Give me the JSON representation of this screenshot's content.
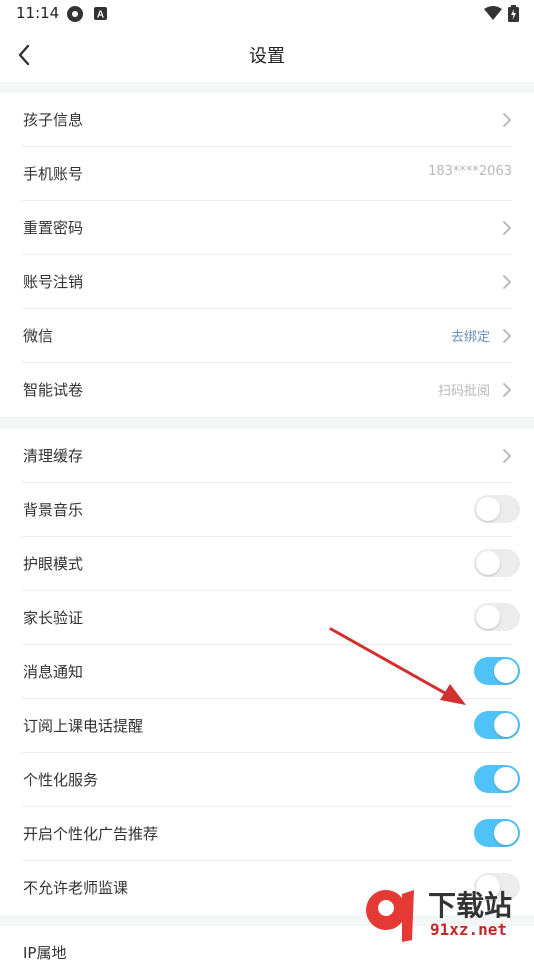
{
  "statusbar": {
    "time": "11:14"
  },
  "header": {
    "title": "设置"
  },
  "section1": [
    {
      "label": "孩子信息",
      "value": "",
      "chevron": true
    },
    {
      "label": "手机账号",
      "value": "183****2063",
      "chevron": false
    },
    {
      "label": "重置密码",
      "value": "",
      "chevron": true
    },
    {
      "label": "账号注销",
      "value": "",
      "chevron": true
    },
    {
      "label": "微信",
      "value": "去绑定",
      "chevron": true
    },
    {
      "label": "智能试卷",
      "value": "扫码批阅",
      "chevron": true
    }
  ],
  "section2": [
    {
      "label": "清理缓存",
      "type": "chevron"
    },
    {
      "label": "背景音乐",
      "type": "toggle",
      "on": false
    },
    {
      "label": "护眼模式",
      "type": "toggle",
      "on": false
    },
    {
      "label": "家长验证",
      "type": "toggle",
      "on": false
    },
    {
      "label": "消息通知",
      "type": "toggle",
      "on": true
    },
    {
      "label": "订阅上课电话提醒",
      "type": "toggle",
      "on": true
    },
    {
      "label": "个性化服务",
      "type": "toggle",
      "on": true
    },
    {
      "label": "开启个性化广告推荐",
      "type": "toggle",
      "on": true
    },
    {
      "label": "不允许老师监课",
      "type": "toggle",
      "on": false
    }
  ],
  "section3": [
    {
      "label": "IP属地"
    }
  ],
  "watermark": {
    "brand": "下载站",
    "url": "91xz.net"
  },
  "colors": {
    "toggle_on": "#4fc3f7",
    "toggle_off": "#ececec",
    "arrow": "#d32f2f"
  }
}
